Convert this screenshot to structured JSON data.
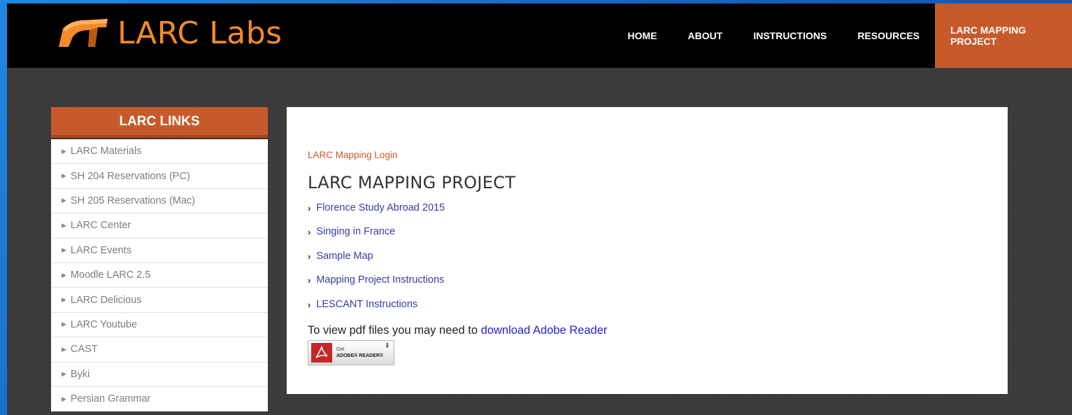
{
  "header": {
    "logo_text": "LARC Labs",
    "nav": [
      {
        "label": "HOME"
      },
      {
        "label": "ABOUT"
      },
      {
        "label": "INSTRUCTIONS"
      },
      {
        "label": "RESOURCES"
      },
      {
        "label": "LARC MAPPING PROJECT",
        "active": true
      }
    ]
  },
  "sidebar": {
    "title": "LARC LINKS",
    "items": [
      {
        "label": "LARC Materials"
      },
      {
        "label": "SH 204 Reservations (PC)"
      },
      {
        "label": "SH 205 Reservations (Mac)"
      },
      {
        "label": "LARC Center"
      },
      {
        "label": "LARC Events"
      },
      {
        "label": "Moodle LARC 2.5"
      },
      {
        "label": "LARC Delicious"
      },
      {
        "label": "LARC Youtube"
      },
      {
        "label": "CAST"
      },
      {
        "label": "Byki"
      },
      {
        "label": "Persian Grammar"
      }
    ]
  },
  "main": {
    "login_link": "LARC Mapping Login",
    "title": "LARC MAPPING PROJECT",
    "projects": [
      {
        "label": "Florence Study Abroad 2015"
      },
      {
        "label": "Singing in France"
      },
      {
        "label": "Sample Map"
      },
      {
        "label": "Mapping Project Instructions"
      },
      {
        "label": "LESCANT Instructions"
      }
    ],
    "pdf_note_prefix": "To view pdf files you may need to ",
    "pdf_note_link": "download Adobe Reader",
    "badge": {
      "get": "Get",
      "product": "ADOBE® READER®"
    }
  },
  "colors": {
    "accent": "#c75a2b",
    "logo": "#f28b2a",
    "link": "#3a3aa8"
  }
}
